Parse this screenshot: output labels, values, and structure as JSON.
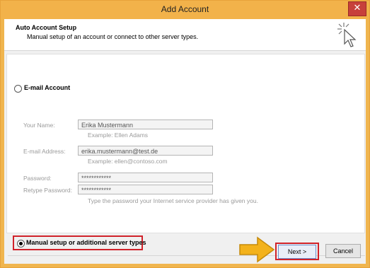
{
  "window": {
    "title": "Add Account",
    "close_glyph": "✕"
  },
  "header": {
    "title": "Auto Account Setup",
    "subtitle": "Manual setup of an account or connect to other server types.",
    "icon": "pointer-click-icon"
  },
  "email_account": {
    "radio_label": "E-mail Account",
    "selected": false
  },
  "form": {
    "your_name": {
      "label": "Your Name:",
      "value": "Erika Mustermann",
      "hint": "Example: Ellen Adams"
    },
    "email": {
      "label": "E-mail Address:",
      "value": "erika.mustermann@test.de",
      "hint": "Example: ellen@contoso.com"
    },
    "password": {
      "label": "Password:",
      "value": "************"
    },
    "retype": {
      "label": "Retype Password:",
      "value": "************"
    },
    "password_hint": "Type the password your Internet service provider has given you."
  },
  "manual": {
    "radio_label": "Manual setup or additional server types",
    "selected": true
  },
  "buttons": {
    "next": "Next >",
    "cancel": "Cancel"
  },
  "colors": {
    "title_bar": "#f2b24a",
    "highlight": "#d0222a",
    "arrow": "#f3b21b"
  }
}
